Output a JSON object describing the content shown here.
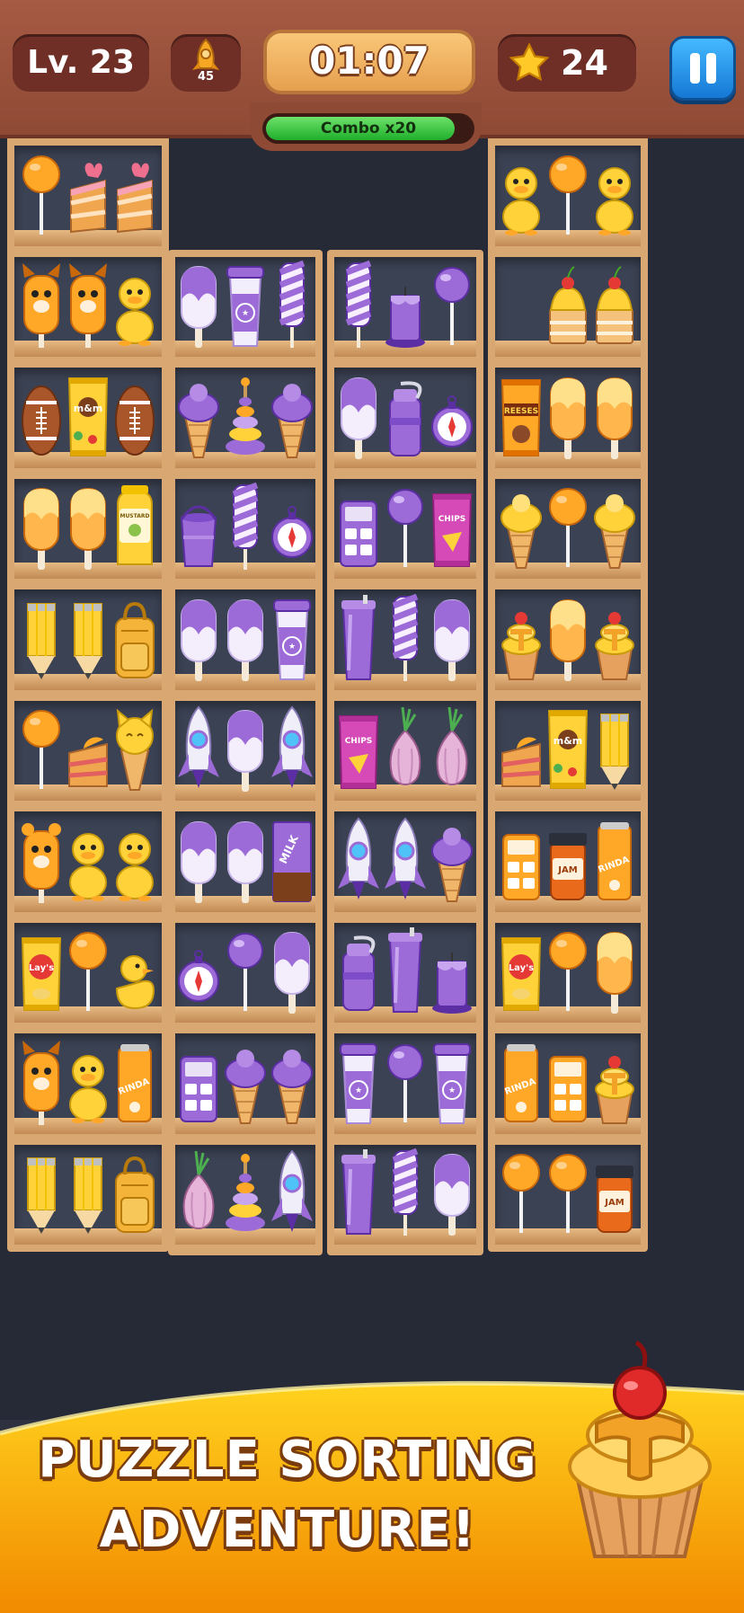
{
  "hud": {
    "level": "Lv. 23",
    "rocket_count": "45",
    "timer": "01:07",
    "stars": "24",
    "combo": "Combo x20",
    "combo_progress": 0.92
  },
  "banner": {
    "line1": "PUZZLE SORTING",
    "line2": "ADVENTURE!"
  },
  "item_labels": {
    "coffee": "STAR COFFEE",
    "mnm": "m&m",
    "reeses": "REESES",
    "mustard": "MUSTARD",
    "chips": "CHIPS",
    "milk": "MILK",
    "jam": "JAM",
    "rinda": "RINDA",
    "lays": "Lay's"
  },
  "grid": [
    [
      [
        "lollipop-orange",
        "cake-slice-heart",
        "cake-slice-heart"
      ],
      null,
      null,
      [
        "duck",
        "lollipop-orange",
        "duck"
      ]
    ],
    [
      [
        "fox-popsicle",
        "fox-popsicle",
        "duck"
      ],
      [
        "popsicle-purple",
        "coffee-cup",
        "candy-stick"
      ],
      [
        "candy-stick",
        "candle",
        "lollipop-purple"
      ],
      [
        "cherry-cake",
        "cherry-cake"
      ]
    ],
    [
      [
        "football",
        "mnm-bag",
        "football"
      ],
      [
        "icecream-purple",
        "ring-stack",
        "icecream-purple"
      ],
      [
        "popsicle-purple",
        "thermos",
        "compass"
      ],
      [
        "reeses-bag",
        "popsicle-orange",
        "popsicle-orange"
      ]
    ],
    [
      [
        "popsicle-orange",
        "popsicle-orange",
        "mustard"
      ],
      [
        "bucket",
        "candy-stick",
        "compass"
      ],
      [
        "calculator",
        "lollipop-purple",
        "chips-bag"
      ],
      [
        "icecream-yellow",
        "lollipop-orange",
        "icecream-yellow"
      ]
    ],
    [
      [
        "pencil",
        "pencil",
        "backpack"
      ],
      [
        "popsicle-purple",
        "popsicle-purple",
        "coffee-cup"
      ],
      [
        "tumbler",
        "candy-stick",
        "popsicle-purple"
      ],
      [
        "cupcake-cherry",
        "popsicle-orange",
        "cupcake-cherry"
      ]
    ],
    [
      [
        "lollipop-orange",
        "cake-slice-orange",
        "cat-icecream"
      ],
      [
        "rocket",
        "popsicle-purple",
        "rocket"
      ],
      [
        "chips-bag",
        "onion",
        "onion"
      ],
      [
        "cake-slice-orange",
        "mnm-bag",
        "pencil"
      ]
    ],
    [
      [
        "bear-popsicle",
        "duck",
        "duck"
      ],
      [
        "popsicle-purple",
        "popsicle-purple",
        "milk-bar"
      ],
      [
        "rocket",
        "rocket",
        "icecream-purple"
      ],
      [
        "calculator-orange",
        "jam-jar",
        "rinda-can"
      ]
    ],
    [
      [
        "lays-bag",
        "lollipop-orange",
        "rubber-duck"
      ],
      [
        "compass",
        "lollipop-purple",
        "popsicle-purple"
      ],
      [
        "thermos",
        "tumbler",
        "candle"
      ],
      [
        "lays-bag",
        "lollipop-orange",
        "popsicle-orange"
      ]
    ],
    [
      [
        "fox-popsicle",
        "duck",
        "rinda-can"
      ],
      [
        "calculator",
        "icecream-purple",
        "icecream-purple"
      ],
      [
        "coffee-cup",
        "lollipop-purple",
        "coffee-cup"
      ],
      [
        "rinda-can",
        "calculator-orange",
        "cupcake-cherry"
      ]
    ],
    [
      [
        "pencil",
        "pencil",
        "backpack"
      ],
      [
        "onion",
        "ring-stack",
        "rocket"
      ],
      [
        "tumbler",
        "candy-stick",
        "popsicle-purple"
      ],
      [
        "lollipop-orange",
        "lollipop-orange",
        "jam-jar"
      ]
    ]
  ]
}
